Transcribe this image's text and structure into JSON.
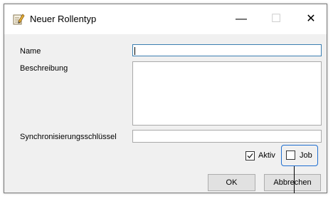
{
  "window": {
    "title": "Neuer Rollentyp",
    "controls": {
      "minimize": "—",
      "maximize": "☐",
      "close": "✕"
    }
  },
  "form": {
    "name_label": "Name",
    "name_value": "",
    "description_label": "Beschreibung",
    "description_value": "",
    "sync_key_label": "Synchronisierungsschlüssel",
    "sync_key_value": "",
    "active_label": "Aktiv",
    "active_checked": true,
    "job_label": "Job",
    "job_checked": false
  },
  "buttons": {
    "ok": "OK",
    "cancel": "Abbrechen"
  },
  "colors": {
    "focus_border": "#3c7fb1",
    "highlight": "#1f6fd1",
    "button_bg": "#e1e1e1"
  }
}
